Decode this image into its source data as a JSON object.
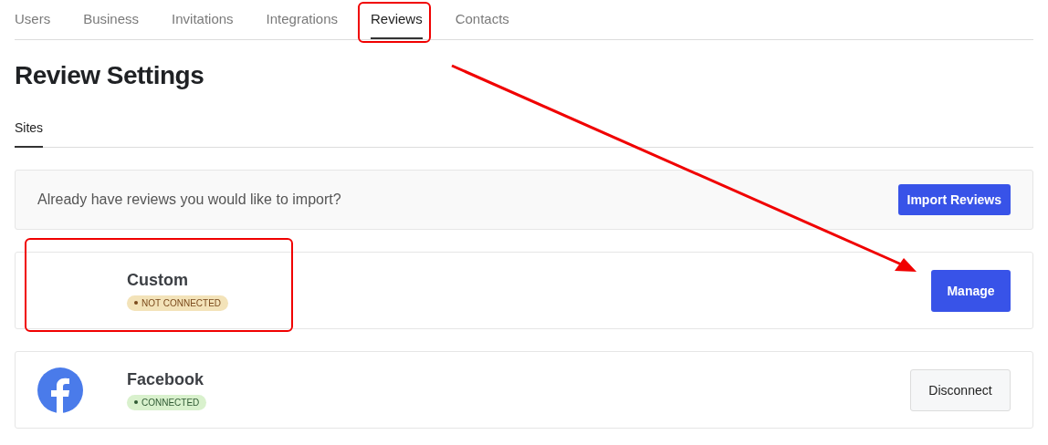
{
  "tabs": [
    {
      "label": "Users",
      "selected": false,
      "highlighted": false
    },
    {
      "label": "Business",
      "selected": false,
      "highlighted": false
    },
    {
      "label": "Invitations",
      "selected": false,
      "highlighted": false
    },
    {
      "label": "Integrations",
      "selected": false,
      "highlighted": false
    },
    {
      "label": "Reviews",
      "selected": true,
      "highlighted": true
    },
    {
      "label": "Contacts",
      "selected": false,
      "highlighted": false
    }
  ],
  "title": "Review Settings",
  "subtabs": [
    {
      "label": "Sites",
      "selected": true
    }
  ],
  "import_banner": {
    "text": "Already have reviews you would like to import?",
    "button": "Import Reviews"
  },
  "sites": [
    {
      "name": "Custom",
      "has_logo": false,
      "status": "NOT CONNECTED",
      "connected": false,
      "button": "Manage",
      "highlighted": true,
      "arrow_target": true
    },
    {
      "name": "Facebook",
      "has_logo": true,
      "status": "CONNECTED",
      "connected": true,
      "button": "Disconnect",
      "highlighted": false,
      "arrow_target": false
    }
  ]
}
